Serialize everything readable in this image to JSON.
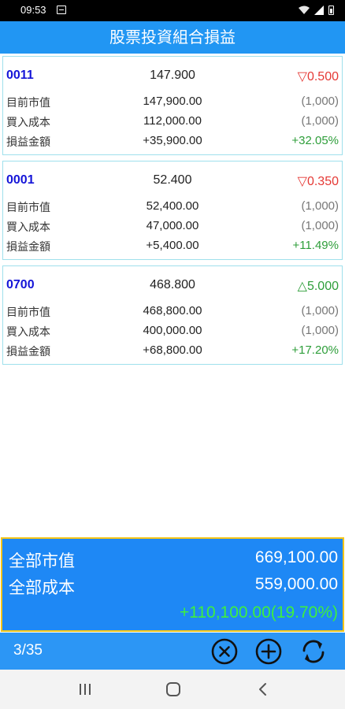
{
  "status_bar": {
    "time": "09:53"
  },
  "header": {
    "title": "股票投資組合損益"
  },
  "stocks": [
    {
      "code": "0011",
      "price": "147.900",
      "change": "▽0.500",
      "direction": "down",
      "rows": [
        {
          "label": "目前市值",
          "value": "147,900.00",
          "extra": "(1,000)"
        },
        {
          "label": "買入成本",
          "value": "112,000.00",
          "extra": "(1,000)"
        },
        {
          "label": "損益金額",
          "value": "+35,900.00",
          "extra": "+32.05%"
        }
      ]
    },
    {
      "code": "0001",
      "price": "52.400",
      "change": "▽0.350",
      "direction": "down",
      "rows": [
        {
          "label": "目前市值",
          "value": "52,400.00",
          "extra": "(1,000)"
        },
        {
          "label": "買入成本",
          "value": "47,000.00",
          "extra": "(1,000)"
        },
        {
          "label": "損益金額",
          "value": "+5,400.00",
          "extra": "+11.49%"
        }
      ]
    },
    {
      "code": "0700",
      "price": "468.800",
      "change": "△5.000",
      "direction": "up",
      "rows": [
        {
          "label": "目前市值",
          "value": "468,800.00",
          "extra": "(1,000)"
        },
        {
          "label": "買入成本",
          "value": "400,000.00",
          "extra": "(1,000)"
        },
        {
          "label": "損益金額",
          "value": "+68,800.00",
          "extra": "+17.20%"
        }
      ]
    }
  ],
  "summary": {
    "market_label": "全部市值",
    "market_value": "669,100.00",
    "cost_label": "全部成本",
    "cost_value": "559,000.00",
    "gain": "+110,100.00(19.70%)"
  },
  "toolbar": {
    "page": "3/35",
    "buttons": [
      "close-circle-icon",
      "add-circle-icon",
      "refresh-icon"
    ]
  },
  "colors": {
    "header": "#2196f3",
    "summary_bg": "#1e88f5",
    "summary_border": "#f5c518",
    "gain_text": "#3ef03e",
    "up": "#2e9e3a",
    "down": "#e53935",
    "code": "#1515d8"
  }
}
